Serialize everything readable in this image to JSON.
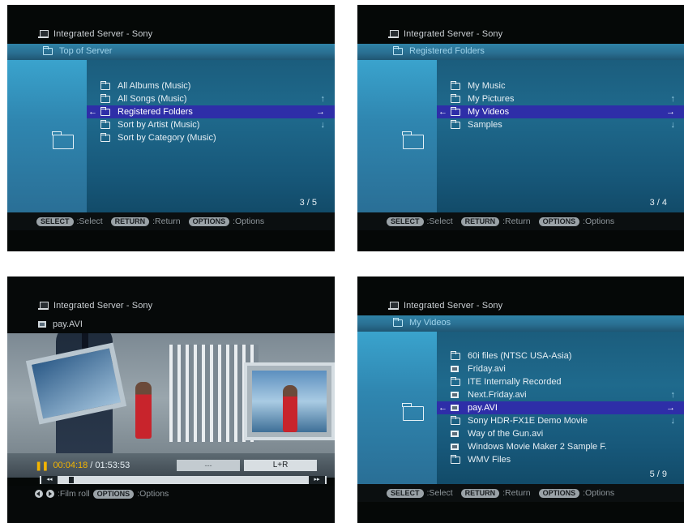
{
  "panel1": {
    "server": "Integrated Server - Sony",
    "crumb": "Top of Server",
    "items": [
      {
        "label": "All Albums (Music)",
        "icon": "music-folder-icon"
      },
      {
        "label": "All Songs (Music)",
        "icon": "music-folder-icon"
      },
      {
        "label": "Registered Folders",
        "icon": "folder-icon",
        "selected": true
      },
      {
        "label": "Sort by Artist (Music)",
        "icon": "music-folder-icon"
      },
      {
        "label": "Sort by Category (Music)",
        "icon": "music-folder-icon"
      }
    ],
    "counter": "3 / 5"
  },
  "panel2": {
    "server": "Integrated Server - Sony",
    "crumb": "Registered Folders",
    "items": [
      {
        "label": "My Music",
        "icon": "folder-icon"
      },
      {
        "label": "My Pictures",
        "icon": "folder-icon"
      },
      {
        "label": "My Videos",
        "icon": "folder-icon",
        "selected": true
      },
      {
        "label": "Samples",
        "icon": "folder-icon"
      }
    ],
    "counter": "3 / 4"
  },
  "panel3": {
    "server": "Integrated Server - Sony",
    "title": "pay.AVI",
    "time_now": "00:04:18",
    "time_total": "/ 01:53:53",
    "box1": "---",
    "box2": "L+R",
    "hint_label": ":Film roll",
    "options_pill": "OPTIONS",
    "options_label": ":Options",
    "seek_left": "◂◂",
    "seek_right": "▸▸",
    "progress": 0.04
  },
  "panel4": {
    "server": "Integrated Server - Sony",
    "crumb": "My Videos",
    "items": [
      {
        "label": "60i files (NTSC USA-Asia)",
        "icon": "folder-icon"
      },
      {
        "label": "Friday.avi",
        "icon": "video-file-icon"
      },
      {
        "label": "ITE Internally Recorded",
        "icon": "folder-icon"
      },
      {
        "label": "Next.Friday.avi",
        "icon": "video-file-icon"
      },
      {
        "label": "pay.AVI",
        "icon": "video-file-icon",
        "selected": true
      },
      {
        "label": "Sony HDR-FX1E Demo Movie",
        "icon": "folder-icon"
      },
      {
        "label": "Way of the Gun.avi",
        "icon": "video-file-icon"
      },
      {
        "label": "Windows Movie Maker 2 Sample F.",
        "icon": "video-file-icon"
      },
      {
        "label": "WMV Files",
        "icon": "folder-icon"
      }
    ],
    "counter": "5 / 9"
  },
  "hints": {
    "select_pill": "SELECT",
    "select_label": ":Select",
    "return_pill": "RETURN",
    "return_label": ":Return",
    "options_pill": "OPTIONS",
    "options_label": ":Options"
  }
}
